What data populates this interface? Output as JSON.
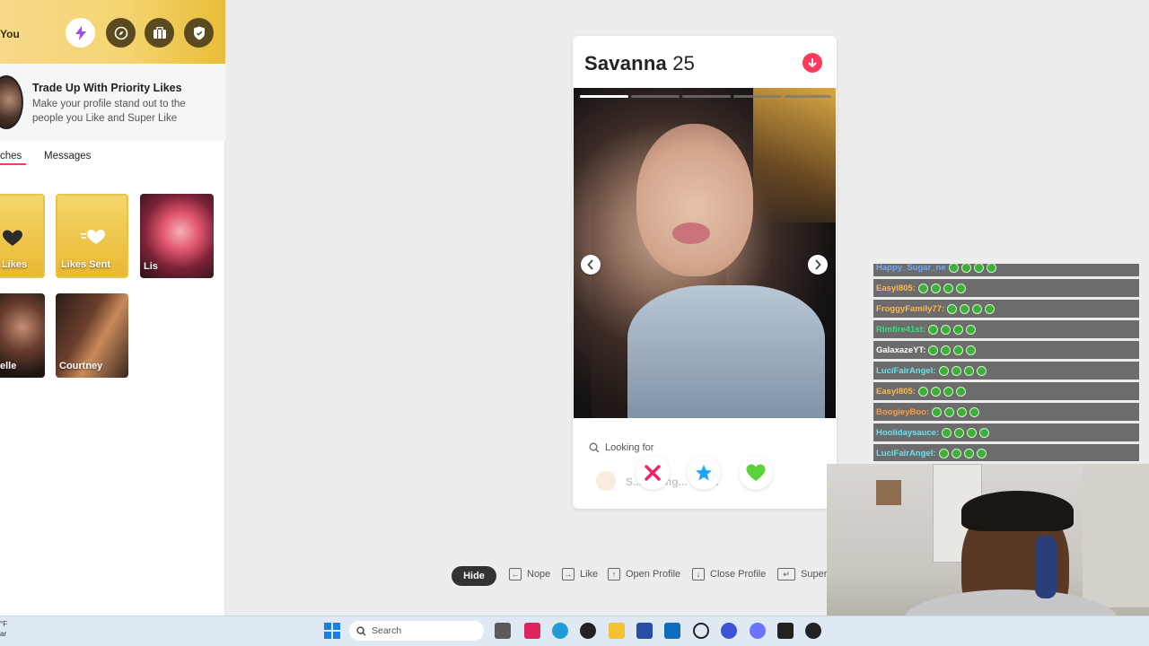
{
  "sidebar": {
    "header_label": "You",
    "header_buttons": [
      "lightning-icon",
      "compass-icon",
      "briefcase-icon",
      "shield-icon"
    ],
    "promo": {
      "title": "Trade Up With Priority Likes",
      "subtitle": "Make your profile stand out to the people you Like and Super Like"
    },
    "tabs": [
      {
        "label": "ches",
        "active": true
      },
      {
        "label": "Messages",
        "active": false
      }
    ],
    "tiles_row1": [
      {
        "label": "Likes"
      },
      {
        "label": "Likes Sent"
      },
      {
        "label": "Lis"
      }
    ],
    "tiles_row2": [
      {
        "label": "elle"
      },
      {
        "label": "Courtney"
      }
    ]
  },
  "profile": {
    "name": "Savanna",
    "age": "25",
    "looking_for_label": "Looking for",
    "looking_for_value": "S... during... cou...",
    "photo_count": 5,
    "current_photo": 1
  },
  "actions": {
    "nope_icon": "x-icon",
    "super_icon": "star-icon",
    "like_icon": "heart-icon"
  },
  "shortcuts": {
    "hide": "Hide",
    "items": [
      {
        "key": "←",
        "label": "Nope"
      },
      {
        "key": "→",
        "label": "Like"
      },
      {
        "key": "↑",
        "label": "Open Profile"
      },
      {
        "key": "↓",
        "label": "Close Profile"
      },
      {
        "key": "↵",
        "label": "Super"
      }
    ]
  },
  "chat": {
    "messages": [
      {
        "user": "Happy_Sugar_ne",
        "color": "#6ea8ff"
      },
      {
        "user": "Easyl805:",
        "color": "#ffb84d"
      },
      {
        "user": "FroggyFamily77:",
        "color": "#ffb84d"
      },
      {
        "user": "Rimfire41st:",
        "color": "#37e07a"
      },
      {
        "user": "GalaxazeYT:",
        "color": "#ffffff"
      },
      {
        "user": "LuciFairAngel:",
        "color": "#6de0e8"
      },
      {
        "user": "Easyl805:",
        "color": "#ffb84d"
      },
      {
        "user": "BoogieyBoo:",
        "color": "#ff9a3c"
      },
      {
        "user": "Hoolidaysauce:",
        "color": "#6de0e8"
      },
      {
        "user": "LuciFairAngel:",
        "color": "#6de0e8"
      }
    ]
  },
  "taskbar": {
    "search_placeholder": "Search",
    "weather_line1": "°F",
    "weather_line2": "ar"
  },
  "colors": {
    "accent": "#fd3a5a",
    "gold": "#f4d571",
    "chat_bg": "#6c6c6c"
  }
}
